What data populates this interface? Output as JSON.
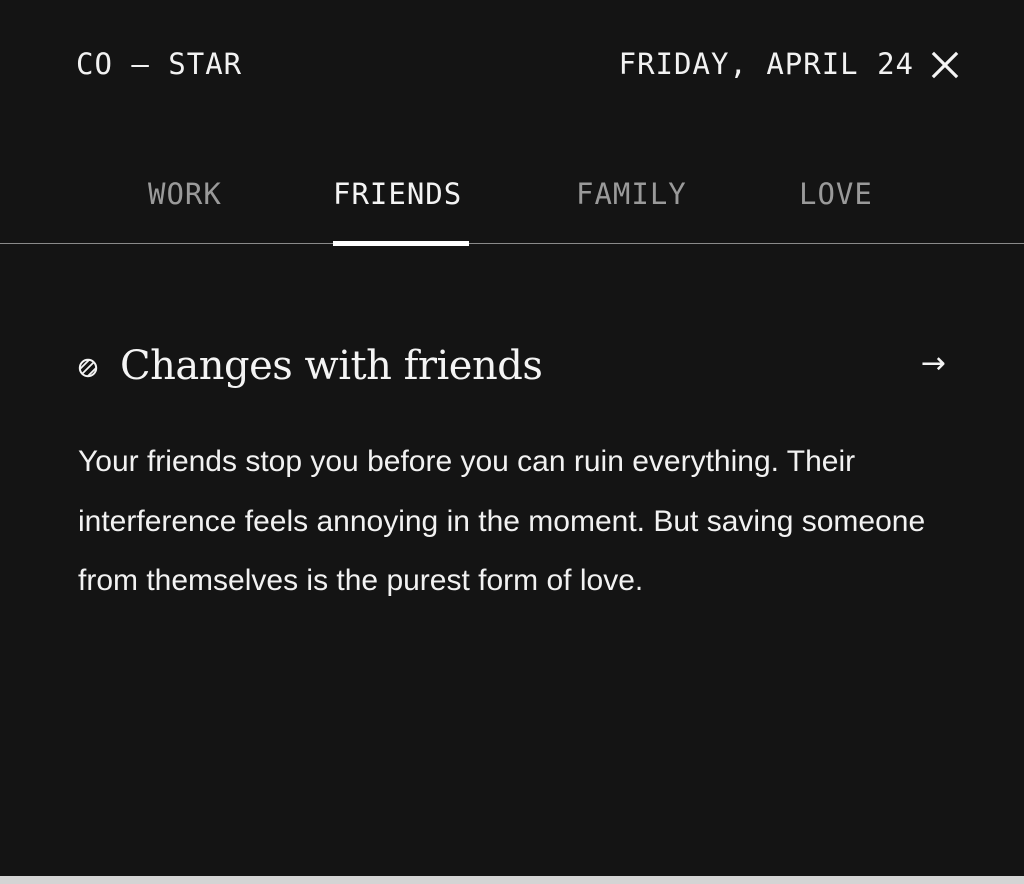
{
  "header": {
    "brand": "CO — STAR",
    "date": "FRIDAY, APRIL 24",
    "close_icon": "close-icon"
  },
  "tabs": [
    {
      "label": "WORK",
      "active": false
    },
    {
      "label": "FRIENDS",
      "active": true
    },
    {
      "label": "FAMILY",
      "active": false
    },
    {
      "label": "LOVE",
      "active": false
    }
  ],
  "card": {
    "bullet_icon": "striped-circle-icon",
    "title": "Changes with friends",
    "arrow": "→",
    "body": "Your friends stop you before you can ruin everything. Their interference feels annoying in the moment. But saving someone from themselves is the purest form of love."
  },
  "colors": {
    "background": "#141414",
    "text": "#f2f2f2",
    "inactive_tab": "#9a9a9a",
    "rule": "#8a8a8a"
  }
}
